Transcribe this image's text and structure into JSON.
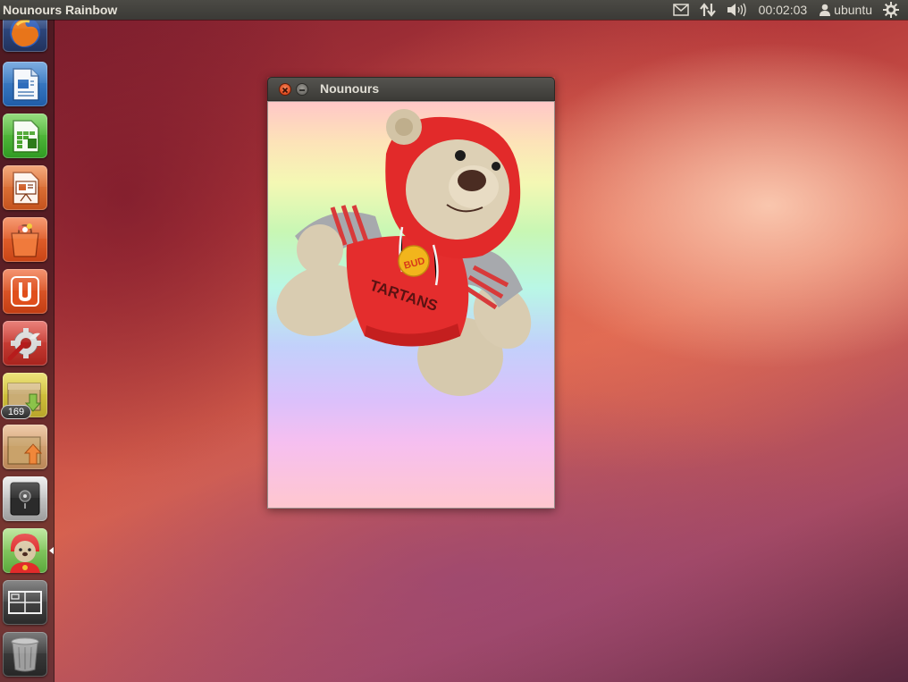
{
  "top_panel": {
    "app_title": "Nounours Rainbow",
    "clock": "00:02:03",
    "user": "ubuntu",
    "indicators": [
      "mail-icon",
      "network-icon",
      "volume-icon",
      "user-icon",
      "power-gear-icon"
    ]
  },
  "launcher": {
    "items": [
      {
        "name": "firefox-icon"
      },
      {
        "name": "libreoffice-writer-icon"
      },
      {
        "name": "libreoffice-calc-icon"
      },
      {
        "name": "libreoffice-impress-icon"
      },
      {
        "name": "ubuntu-software-center-icon"
      },
      {
        "name": "ubuntu-one-icon"
      },
      {
        "name": "system-settings-icon"
      },
      {
        "name": "archive-download-icon"
      },
      {
        "name": "update-manager-icon",
        "badge": "169"
      },
      {
        "name": "safe-icon"
      },
      {
        "name": "nounours-teddy-icon",
        "active": true
      },
      {
        "name": "workspace-switcher-icon"
      },
      {
        "name": "trash-icon"
      }
    ],
    "update_badge": "169"
  },
  "window": {
    "title": "Nounours",
    "background_colors": [
      "#ffc7c7",
      "#f4f8b4",
      "#c8f7b4",
      "#b9f7e6",
      "#c2d1fb",
      "#f6bff0"
    ],
    "shirt_text": "TARTANS",
    "button_text": "BUD"
  }
}
